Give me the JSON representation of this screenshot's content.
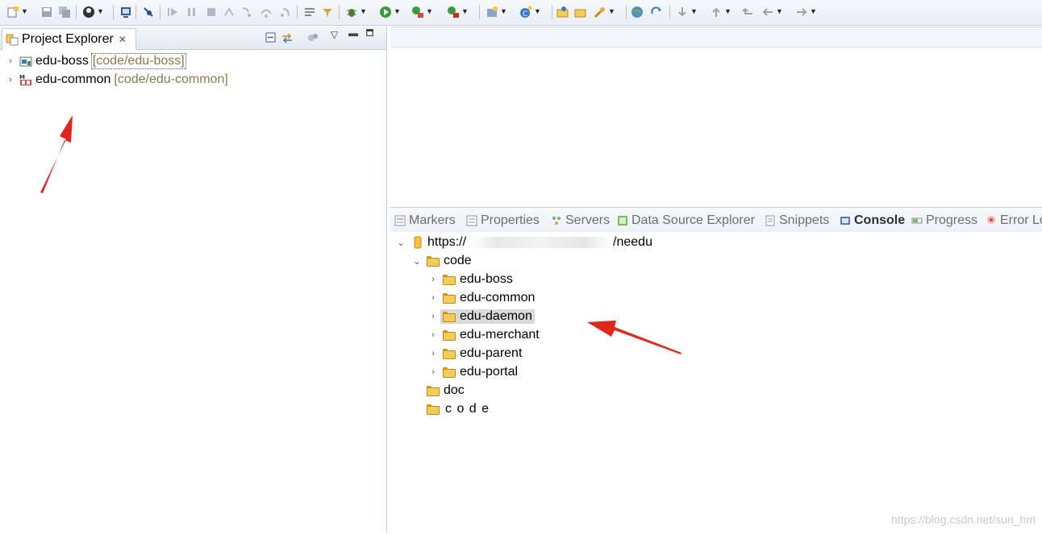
{
  "toolbar": {
    "icons": [
      "new-icon",
      "save-icon",
      "save-all-icon",
      "profile-icon",
      "terminal-icon",
      "skip-breakpoints-icon",
      "resume-icon",
      "suspend-icon",
      "terminate-icon",
      "disconnect-icon",
      "step-into-icon",
      "step-over-icon",
      "step-return-icon",
      "drop-to-frame-icon",
      "use-step-filters-icon",
      "debug-icon",
      "run-icon",
      "coverage-icon",
      "external-tools-icon",
      "new-server-icon",
      "new-java-class-icon",
      "open-type-icon",
      "open-task-icon",
      "search-icon",
      "web-browser-icon",
      "refresh-icon",
      "next-annotation-icon",
      "previous-annotation-icon",
      "last-edit-icon",
      "back-icon",
      "forward-icon"
    ]
  },
  "left_panel": {
    "tab_title": "Project Explorer",
    "close_glyph": "✕",
    "projects": [
      {
        "name": "edu-boss",
        "path": "[code/edu-boss]"
      },
      {
        "name": "edu-common",
        "path": "[code/edu-common]"
      }
    ]
  },
  "bottom_panel": {
    "tabs": [
      {
        "label": "Markers",
        "icon": "markers-icon"
      },
      {
        "label": "Properties",
        "icon": "properties-icon"
      },
      {
        "label": "Servers",
        "icon": "servers-icon"
      },
      {
        "label": "Data Source Explorer",
        "icon": "data-source-icon"
      },
      {
        "label": "Snippets",
        "icon": "snippets-icon"
      },
      {
        "label": "Console",
        "icon": "console-icon",
        "active": true
      },
      {
        "label": "Progress",
        "icon": "progress-icon"
      },
      {
        "label": "Error Lo",
        "icon": "error-log-icon"
      }
    ],
    "repo": {
      "url_visible_start": "https://",
      "url_visible_end": "/needu"
    },
    "tree": {
      "code_folder": "code",
      "children": [
        "edu-boss",
        "edu-common",
        "edu-daemon",
        "edu-merchant",
        "edu-parent",
        "edu-portal"
      ],
      "selected": "edu-daemon",
      "doc_folder": "doc",
      "code_spaced": "c o d e"
    }
  },
  "watermark": "https://blog.csdn.net/sun_hm",
  "colors": {
    "accent_arrow": "#e3261b",
    "folder": "#f4cc5b",
    "path_text": "#8f7a4e"
  }
}
